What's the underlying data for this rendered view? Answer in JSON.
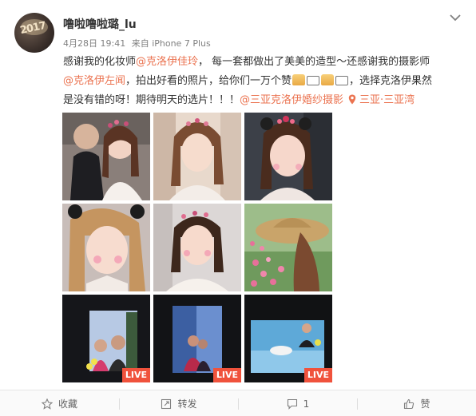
{
  "post": {
    "username": "噜啦噜啦璐_lu",
    "date": "4月28日 19:41",
    "source": "来自 iPhone 7 Plus",
    "text": {
      "l1_a": "感谢我的化妆师",
      "l1_mention": "@克洛伊佳玲",
      "l1_b": "， 每一套都做出了美美的造型～还感谢我的摄影师",
      "l2_mention": "@克洛伊左闻",
      "l2_b": "，拍出好看的照片，给你们一万个赞",
      "l2_c": "，选择克洛伊果然",
      "l3_a": "是没有错的呀！期待明天的选片！！！",
      "l3_mention": "@三亚克洛伊婚纱摄影",
      "l3_location": "三亚·三亚湾"
    },
    "photos": [
      {
        "label": ""
      },
      {
        "label": ""
      },
      {
        "label": ""
      },
      {
        "label": ""
      },
      {
        "label": ""
      },
      {
        "label": ""
      },
      {
        "label": "LIVE"
      },
      {
        "label": "LIVE"
      },
      {
        "label": "LIVE"
      }
    ]
  },
  "footer": {
    "favorite": "收藏",
    "repost": "转发",
    "comment": "1",
    "like": "赞"
  },
  "colors": {
    "link": "#eb7350",
    "live": "#f0523c"
  }
}
